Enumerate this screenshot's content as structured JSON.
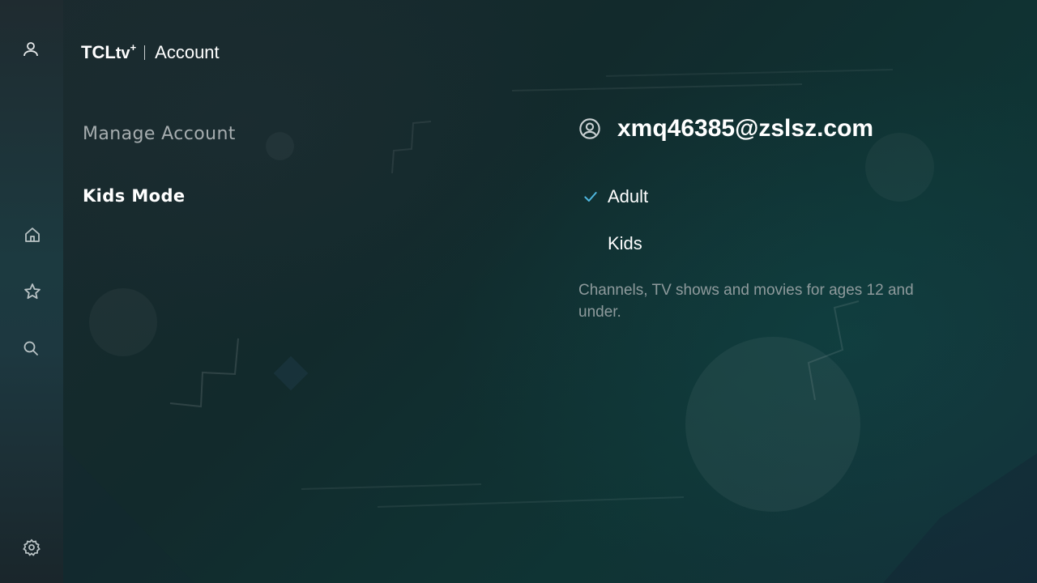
{
  "app": {
    "logo_main": "TCL",
    "logo_tv": "tv",
    "logo_plus": "+",
    "title": "Account"
  },
  "sidebar": {
    "items": [
      {
        "icon": "user-icon"
      },
      {
        "icon": "home-icon"
      },
      {
        "icon": "star-icon"
      },
      {
        "icon": "search-icon"
      },
      {
        "icon": "gear-icon"
      }
    ]
  },
  "menu": {
    "manage_account": "Manage Account",
    "kids_mode": "Kids Mode",
    "selected": "Kids Mode"
  },
  "account": {
    "icon": "account-circle-icon",
    "email": "xmq46385@zslsz.com"
  },
  "kids_mode": {
    "options": [
      {
        "label": "Adult",
        "selected": true
      },
      {
        "label": "Kids",
        "selected": false
      }
    ],
    "description": "Channels, TV shows and movies for ages 12 and under."
  },
  "colors": {
    "check": "#4fb8e0",
    "text_primary": "#ffffff",
    "text_inactive": "#a6adaf",
    "text_muted": "#8e9a9c"
  }
}
